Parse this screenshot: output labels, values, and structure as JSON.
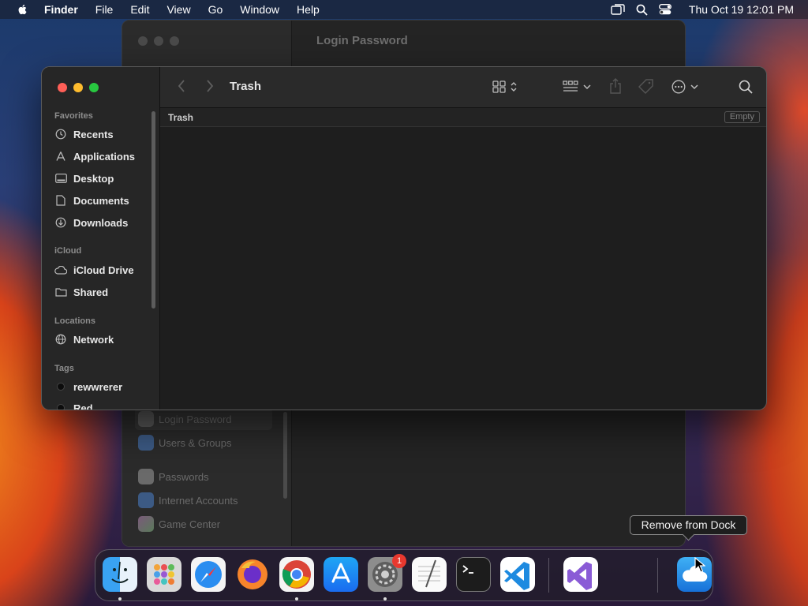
{
  "menubar": {
    "app_name": "Finder",
    "menus": [
      "File",
      "Edit",
      "View",
      "Go",
      "Window",
      "Help"
    ],
    "datetime": "Thu Oct 19  12:01 PM"
  },
  "settings_window": {
    "title": "Login Password",
    "sidebar_items": [
      "Login Password",
      "Users & Groups",
      "Passwords",
      "Internet Accounts",
      "Game Center"
    ]
  },
  "finder": {
    "title": "Trash",
    "path_label": "Trash",
    "empty_button": "Empty",
    "sidebar": {
      "favorites_header": "Favorites",
      "favorites": [
        "Recents",
        "Applications",
        "Desktop",
        "Documents",
        "Downloads"
      ],
      "icloud_header": "iCloud",
      "icloud": [
        "iCloud Drive",
        "Shared"
      ],
      "locations_header": "Locations",
      "locations": [
        "Network"
      ],
      "tags_header": "Tags",
      "tags": [
        "rewwrerer",
        "Red"
      ]
    }
  },
  "dock": {
    "tooltip": "Remove from Dock",
    "badge": "1",
    "apps": [
      "finder-icon",
      "launchpad-icon",
      "safari-icon",
      "firefox-icon",
      "chrome-icon",
      "app-store-icon",
      "system-settings-icon",
      "textedit-icon",
      "terminal-icon",
      "vscode-icon",
      "visual-studio-icon",
      "icloud-icon"
    ]
  },
  "colors": {
    "close": "#ff5f57",
    "minimize": "#febc2e",
    "zoom": "#28c840",
    "accent": "#0a84ff"
  }
}
